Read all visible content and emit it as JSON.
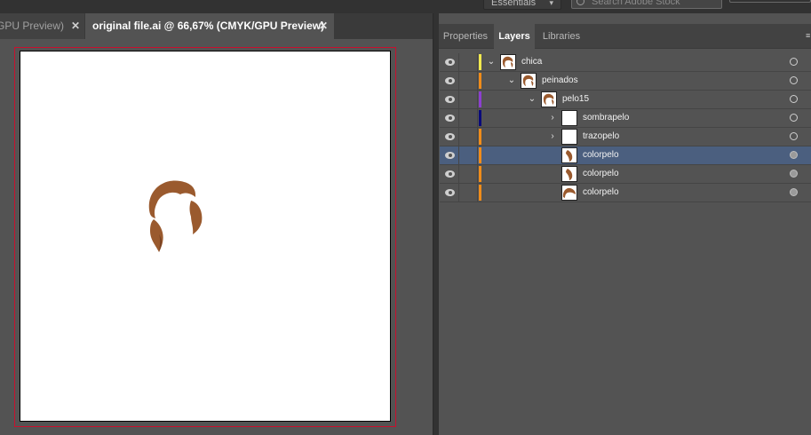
{
  "topbar": {
    "workspace_label": "Essentials",
    "workspace_icon": "chevron-down-icon",
    "search_placeholder": "Search Adobe Stock"
  },
  "doc_tabs": [
    {
      "label": "GPU Preview)",
      "close": "✕"
    },
    {
      "label": "original file.ai @ 66,67% (CMYK/GPU Preview)",
      "close": "✕"
    }
  ],
  "colors": {
    "hair": "#9a5a2e",
    "hair_shadow": "#7a4323",
    "bleed": "#c8102e",
    "selection": "#4b5f7f"
  },
  "panel": {
    "tabs": [
      "Properties",
      "Layers",
      "Libraries"
    ],
    "active_tab": "Layers",
    "menu_icon": "panel-menu-icon"
  },
  "layers": [
    {
      "name": "chica",
      "color": "#f2e94e",
      "toggle": "⌄",
      "thumb": "hair-thumb",
      "depth": 0,
      "selected": false,
      "target_filled": false
    },
    {
      "name": "peinados",
      "color": "#f08c1a",
      "toggle": "⌄",
      "thumb": "hair-thumb",
      "depth": 1,
      "selected": false,
      "target_filled": false
    },
    {
      "name": "pelo15",
      "color": "#8c3fd0",
      "toggle": "⌄",
      "thumb": "hair-thumb",
      "depth": 2,
      "selected": false,
      "target_filled": false
    },
    {
      "name": "sombrapelo",
      "color": "#0a0a7a",
      "toggle": "›",
      "thumb": "blank-thumb",
      "depth": 3,
      "selected": false,
      "target_filled": false
    },
    {
      "name": "trazopelo",
      "color": "#f08c1a",
      "toggle": "›",
      "thumb": "blank-thumb",
      "depth": 3,
      "selected": false,
      "target_filled": false
    },
    {
      "name": "colorpelo",
      "color": "#f08c1a",
      "toggle": "",
      "thumb": "hair-piece-thumb",
      "depth": 3,
      "selected": true,
      "target_filled": true
    },
    {
      "name": "colorpelo",
      "color": "#f08c1a",
      "toggle": "",
      "thumb": "hair-piece-thumb",
      "depth": 3,
      "selected": false,
      "target_filled": true
    },
    {
      "name": "colorpelo",
      "color": "#f08c1a",
      "toggle": "",
      "thumb": "hair-top-thumb",
      "depth": 3,
      "selected": false,
      "target_filled": true
    }
  ]
}
